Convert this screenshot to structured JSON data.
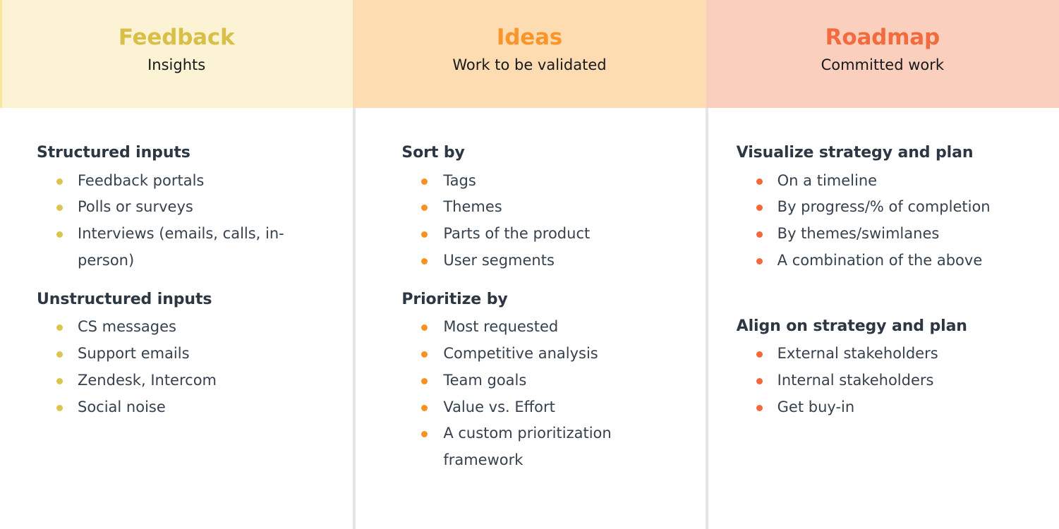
{
  "columns": [
    {
      "key": "feedback",
      "title": "Feedback",
      "subtitle": "Insights",
      "title_color": "#d8bf48",
      "header_bg": "#fbf3d3",
      "edge_accent": "#f6e79b",
      "bullet_color": "#dcc44f",
      "sections": [
        {
          "heading": "Structured inputs",
          "items": [
            "Feedback portals",
            "Polls or surveys",
            "Interviews (emails, calls, in-person)"
          ]
        },
        {
          "heading": "Unstructured inputs",
          "items": [
            "CS messages",
            "Support emails",
            "Zendesk, Intercom",
            "Social noise"
          ]
        }
      ]
    },
    {
      "key": "ideas",
      "title": "Ideas",
      "subtitle": "Work to be validated",
      "title_color": "#f9952a",
      "header_bg": "#fedcb2",
      "edge_accent": "#fedcb2",
      "bullet_color": "#fb9123",
      "sections": [
        {
          "heading": "Sort by",
          "items": [
            "Tags",
            "Themes",
            "Parts of the product",
            "User segments"
          ]
        },
        {
          "heading": "Prioritize by",
          "items": [
            "Most requested",
            "Competitive analysis",
            "Team goals",
            "Value vs. Effort",
            "A custom prioritization framework"
          ]
        }
      ]
    },
    {
      "key": "roadmap",
      "title": "Roadmap",
      "subtitle": "Committed work",
      "title_color": "#f26b3f",
      "header_bg": "#fbcfbd",
      "edge_accent": "#fbcfbd",
      "bullet_color": "#f4683c",
      "sections": [
        {
          "heading": "Visualize strategy and plan",
          "items": [
            "On a timeline",
            "By progress/% of completion",
            "By themes/swimlanes",
            "A combination of the above"
          ]
        },
        {
          "heading": "Align on strategy and plan",
          "items": [
            "External stakeholders",
            "Internal stakeholders",
            "Get buy-in"
          ]
        }
      ]
    }
  ],
  "divider_color": "#e3e6e9",
  "body_text_color": "#36414e",
  "heading_text_color": "#2c3743"
}
